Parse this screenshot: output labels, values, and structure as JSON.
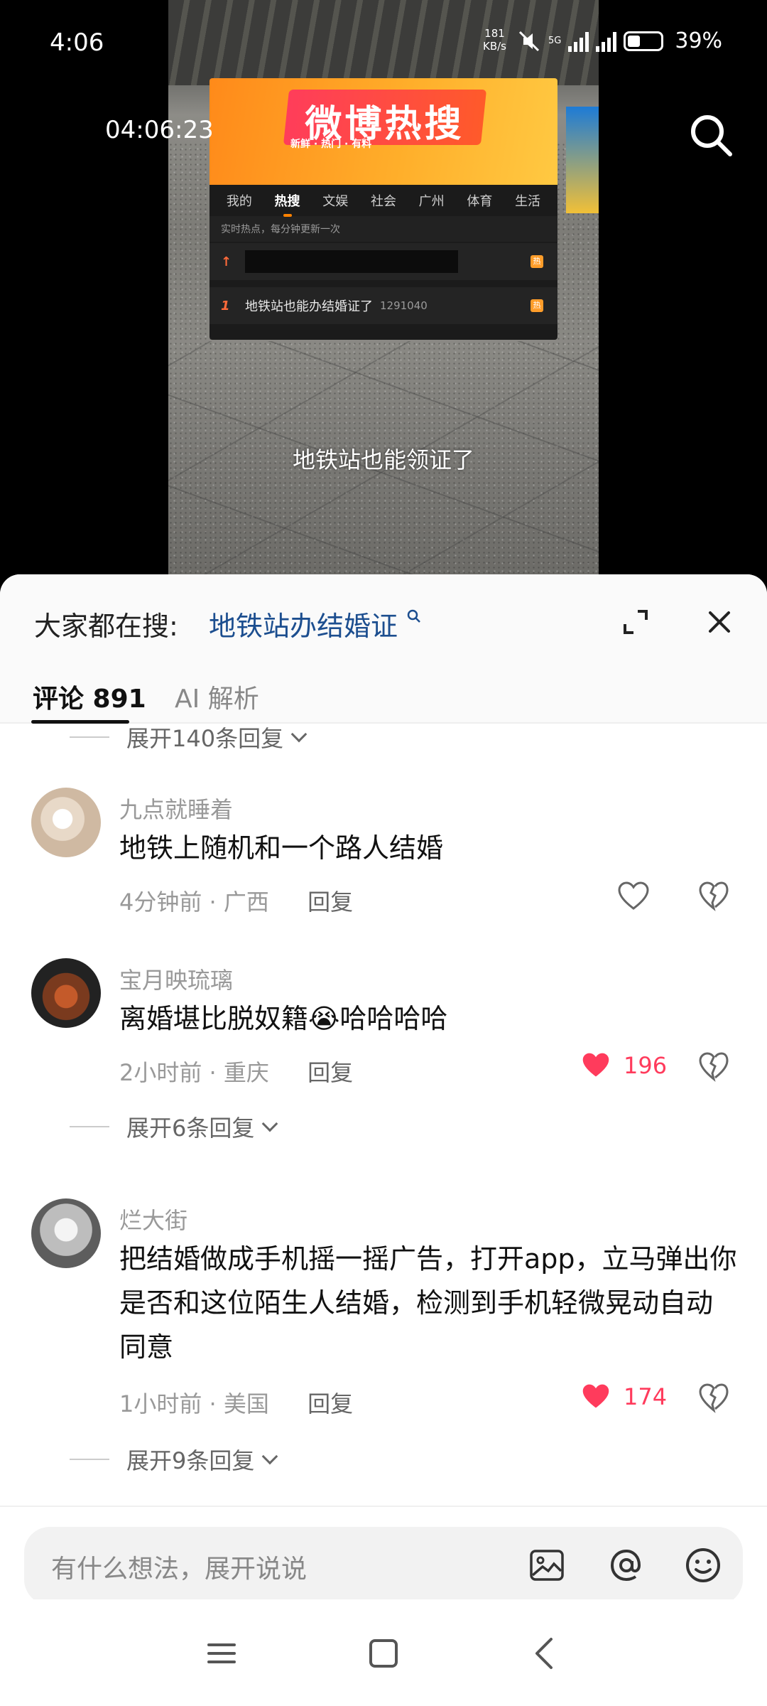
{
  "status_bar": {
    "time": "4:06",
    "net_speed_value": "181",
    "net_speed_unit": "KB/s",
    "network": "5G",
    "battery_percent": "39%",
    "battery_level": 0.39
  },
  "video": {
    "timestamp": "04:06:23",
    "subtitle": "地铁站也能领证了",
    "hot_search": {
      "logo_text": "微博热搜",
      "tagline": "新鲜 · 热门 · 有料",
      "tabs": [
        "我的",
        "热搜",
        "文娱",
        "社会",
        "广州",
        "体育",
        "生活"
      ],
      "active_tab": "热搜",
      "note": "实时热点，每分钟更新一次",
      "pinned_rank": "↑",
      "item_rank": "1",
      "item_title": "地铁站也能办结婚证了",
      "item_count": "1291040",
      "badge": "热"
    }
  },
  "sheet": {
    "suggest_label": "大家都在搜:",
    "suggest_query": "地铁站办结婚证",
    "tabs": {
      "comments": "评论 891",
      "ai": "AI 解析"
    },
    "expand_top": "展开140条回复",
    "comments": [
      {
        "author": "九点就睡着",
        "text": "地铁上随机和一个路人结婚",
        "time_loc": "4分钟前 · 广西",
        "reply": "回复",
        "likes": ""
      },
      {
        "author": "宝月映琉璃",
        "text": "离婚堪比脱奴籍😭哈哈哈哈",
        "time_loc": "2小时前 · 重庆",
        "reply": "回复",
        "likes": "196",
        "expand": "展开6条回复"
      },
      {
        "author": "烂大街",
        "text": "把结婚做成手机摇一摇广告，打开app，立马弹出你是否和这位陌生人结婚，检测到手机轻微晃动自动同意",
        "time_loc": "1小时前 · 美国",
        "reply": "回复",
        "likes": "174",
        "expand": "展开9条回复"
      }
    ],
    "input_placeholder": "有什么想法，展开说说"
  },
  "colors": {
    "like_red": "#ff3b5c",
    "query_blue": "#1c4e8f",
    "hot_orange": "#ff8200"
  },
  "icons": {
    "search": "search-icon",
    "expand": "expand-icon",
    "close": "close-icon",
    "heart": "heart-icon",
    "dislike": "broken-heart-icon",
    "image": "image-icon",
    "mention": "at-icon",
    "emoji": "emoji-icon",
    "menu": "menu-icon",
    "home": "home-icon",
    "back": "back-icon"
  }
}
